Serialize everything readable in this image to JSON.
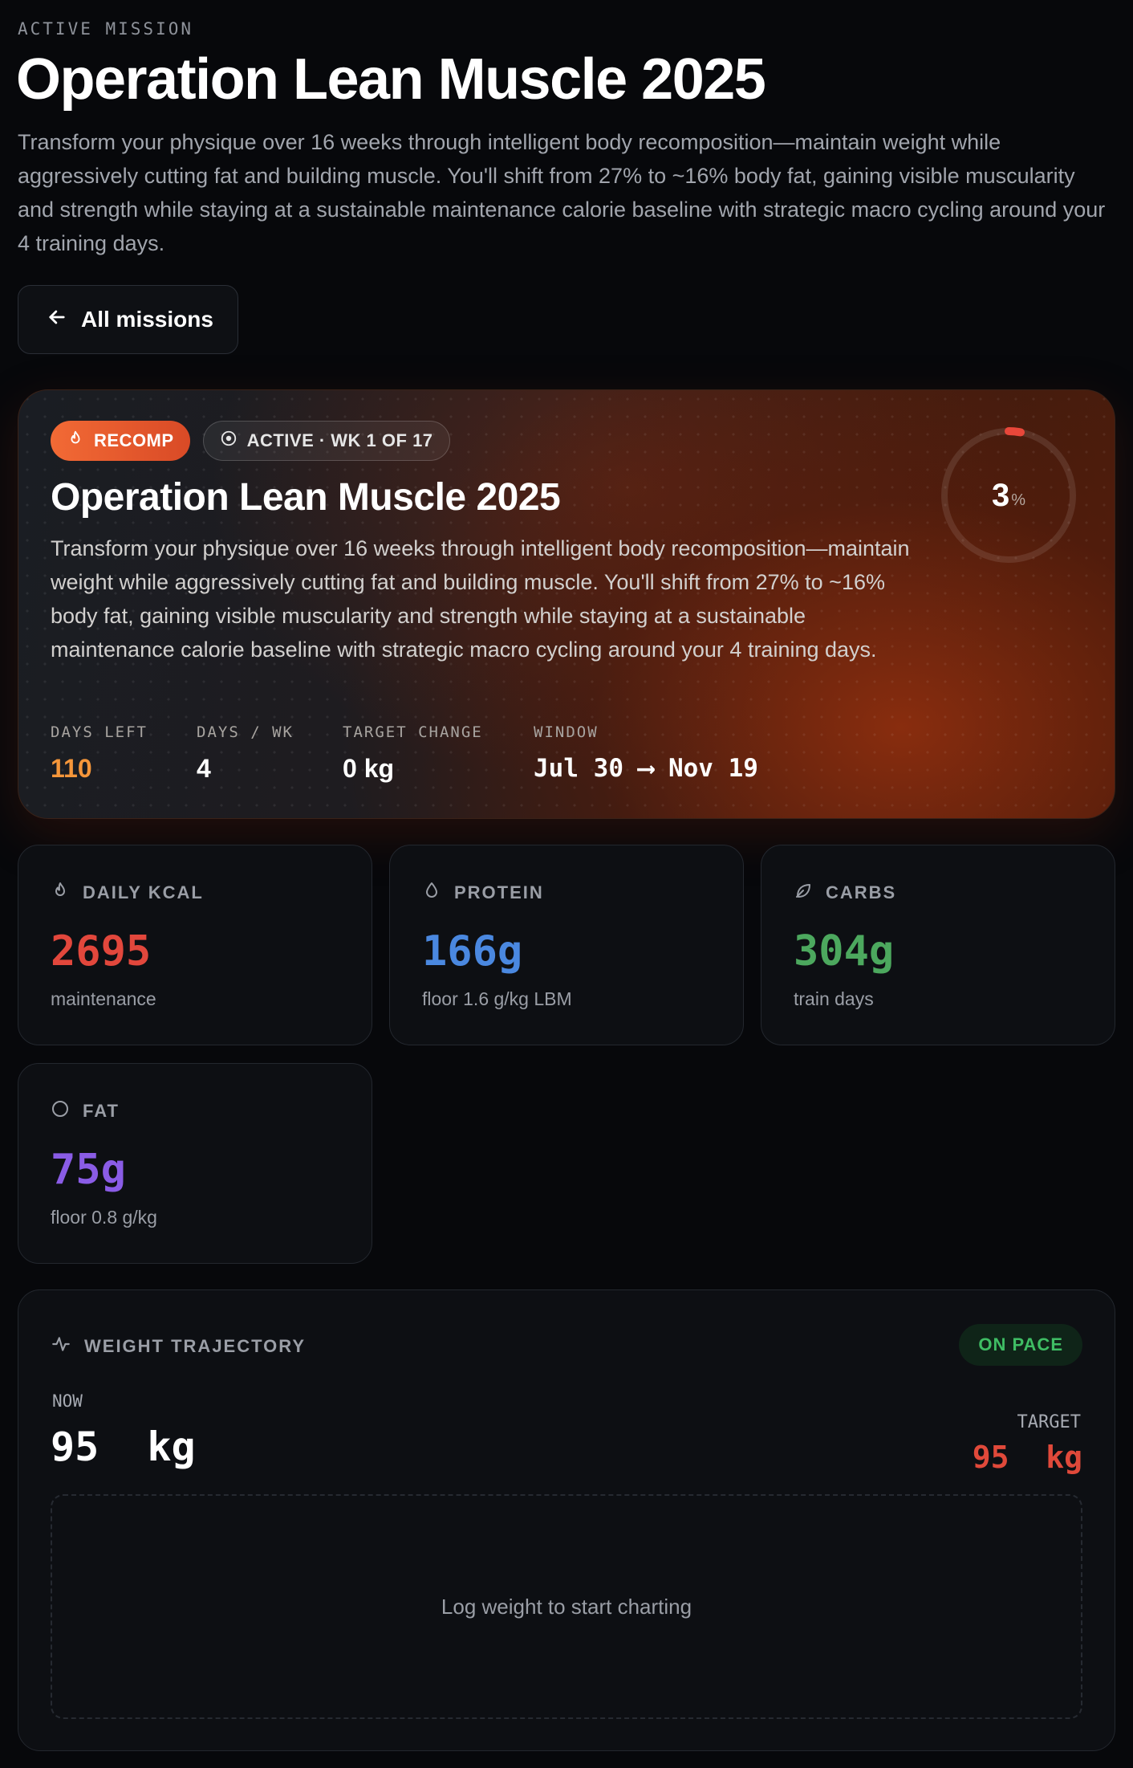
{
  "header": {
    "eyebrow": "ACTIVE MISSION",
    "title": "Operation Lean Muscle 2025",
    "description": "Transform your physique over 16 weeks through intelligent body recomposition—maintain weight while aggressively cutting fat and building muscle. You'll shift from 27% to ~16% body fat, gaining visible muscularity and strength while staying at a sustainable maintenance calorie baseline with strategic macro cycling around your 4 training days.",
    "back_label": "All missions"
  },
  "hero": {
    "badge_type": "RECOMP",
    "badge_status": "ACTIVE · WK 1 OF 17",
    "title": "Operation Lean Muscle 2025",
    "description": "Transform your physique over 16 weeks through intelligent body recomposition—maintain weight while aggressively cutting fat and building muscle. You'll shift from 27% to ~16% body fat, gaining visible muscularity and strength while staying at a sustainable maintenance calorie baseline with strategic macro cycling around your 4 training days.",
    "progress_value": "3",
    "progress_unit": "%",
    "progress_fraction": 0.03,
    "stats": [
      {
        "label": "DAYS LEFT",
        "value": "110"
      },
      {
        "label": "DAYS / WK",
        "value": "4"
      },
      {
        "label": "TARGET CHANGE",
        "value": "0 kg"
      },
      {
        "label": "WINDOW",
        "value": "Jul 30 ⟶ Nov 19"
      }
    ]
  },
  "macros": [
    {
      "icon": "flame-icon",
      "label": "DAILY KCAL",
      "value": "2695",
      "sub": "maintenance",
      "color": "#e2473c"
    },
    {
      "icon": "droplet-icon",
      "label": "PROTEIN",
      "value": "166g",
      "sub": "floor 1.6 g/kg LBM",
      "color": "#4a88e0"
    },
    {
      "icon": "leaf-icon",
      "label": "CARBS",
      "value": "304g",
      "sub": "train days",
      "color": "#4ca85e"
    },
    {
      "icon": "circle-icon",
      "label": "FAT",
      "value": "75g",
      "sub": "floor 0.8 g/kg",
      "color": "#8a5ce6"
    }
  ],
  "weight": {
    "title": "WEIGHT TRAJECTORY",
    "status": "ON PACE",
    "now_label": "NOW",
    "now_value": "95  kg",
    "target_label": "TARGET",
    "target_value": "95  kg",
    "empty_text": "Log weight to start charting"
  },
  "colors": {
    "accent_orange": "#f26a35",
    "on_pace_green": "#3fbd64",
    "target_red": "#e0493a"
  }
}
